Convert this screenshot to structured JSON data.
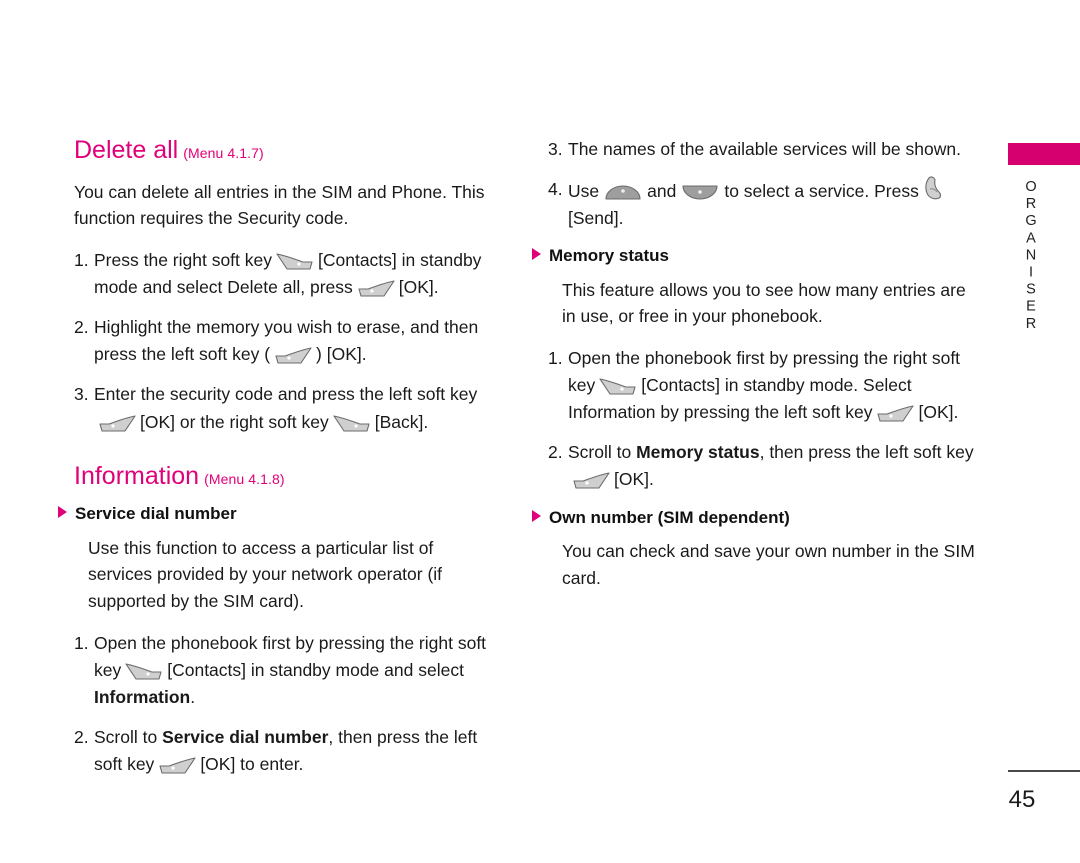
{
  "side_tab": {
    "label": "ORGANISER",
    "bar_color": "#d6006e"
  },
  "accent_color": "#e0007a",
  "left_column": {
    "section1": {
      "title": "Delete all",
      "menu_ref": "(Menu 4.1.7)",
      "intro": "You can delete all entries in the SIM and Phone. This function requires the Security code.",
      "steps": [
        {
          "num": "1.",
          "part1": "Press the right soft key",
          "key1": "right-soft-key",
          "part2": "[Contacts] in standby mode and select Delete all, press",
          "key2": "left-soft-key",
          "part3": "[OK]."
        },
        {
          "num": "2.",
          "part1": "Highlight the memory you wish to erase, and then press the left soft key (",
          "key1": "left-soft-key",
          "part2": ") [OK]."
        },
        {
          "num": "3.",
          "part1": "Enter the security code and press the left soft key",
          "key1": "left-soft-key",
          "part2": "[OK] or the right soft key",
          "key2": "right-soft-key",
          "part3": "[Back]."
        }
      ]
    },
    "section2": {
      "title": "Information",
      "menu_ref": "(Menu 4.1.8)",
      "sub_head": "Service dial number",
      "intro": "Use this function to access a particular list of services provided by your network operator (if supported by the SIM card).",
      "steps": [
        {
          "num": "1.",
          "part1": "Open the phonebook first by pressing the right soft key",
          "key1": "right-soft-key",
          "part2": "[Contacts] in standby mode and select ",
          "bold1": "Information",
          "part3": "."
        },
        {
          "num": "2.",
          "part1": "Scroll to ",
          "bold1": "Service dial number",
          "part2": ", then press the left soft key",
          "key1": "left-soft-key",
          "part3": "[OK] to enter."
        }
      ]
    }
  },
  "right_column": {
    "steps_top": [
      {
        "num": "3.",
        "part1": "The names of the available services will be shown."
      },
      {
        "num": "4.",
        "part1": "Use",
        "key1": "nav-up-key",
        "part2": "and",
        "key2": "nav-down-key",
        "part3": "to select a service. Press",
        "key3": "send-key",
        "part4": "[Send]."
      }
    ],
    "section_memory": {
      "sub_head": "Memory status",
      "intro": "This feature allows you to see how many entries are in use, or free in your phonebook.",
      "steps": [
        {
          "num": "1.",
          "part1": "Open the phonebook first by pressing the right soft key",
          "key1": "right-soft-key",
          "part2": "[Contacts] in standby mode. Select Information by pressing the left soft key",
          "key2": "left-soft-key",
          "part3": "[OK]."
        },
        {
          "num": "2.",
          "part1": "Scroll to ",
          "bold1": "Memory status",
          "part2": ", then press the left soft key",
          "key1": "left-soft-key",
          "part3": "[OK]."
        }
      ]
    },
    "section_own": {
      "sub_head": "Own number (SIM dependent)",
      "intro": "You can check and save your own number in the SIM card."
    }
  },
  "footer": {
    "page_number": "45"
  }
}
